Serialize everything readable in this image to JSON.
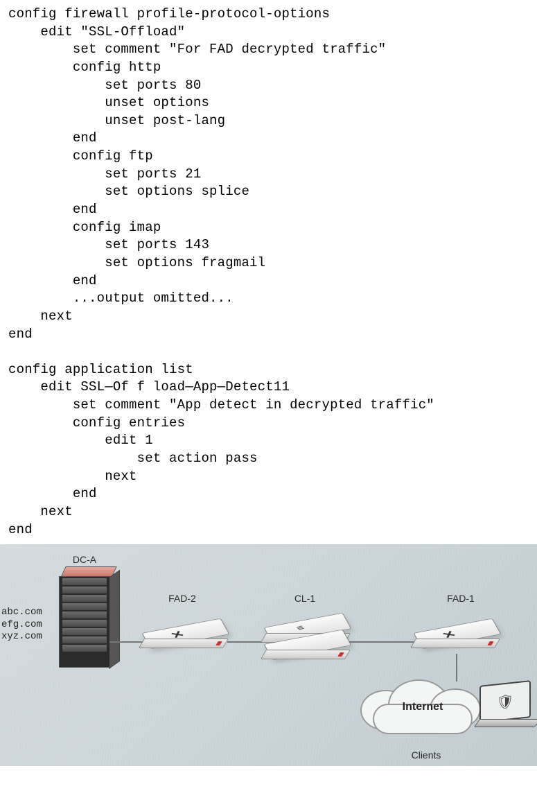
{
  "code": {
    "l01": "config firewall profile-protocol-options",
    "l02": "    edit \"SSL-Offload\"",
    "l03": "        set comment \"For FAD decrypted traffic\"",
    "l04": "        config http",
    "l05": "            set ports 80",
    "l06": "            unset options",
    "l07": "            unset post-lang",
    "l08": "        end",
    "l09": "        config ftp",
    "l10": "            set ports 21",
    "l11": "            set options splice",
    "l12": "        end",
    "l13": "        config imap",
    "l14": "            set ports 143",
    "l15": "            set options fragmail",
    "l16": "        end",
    "l17": "        ...output omitted...",
    "l18": "    next",
    "l19": "end",
    "l20": "",
    "l21": "config application list",
    "l22": "    edit SSL—Of f load—App—Detect11",
    "l23": "        set comment \"App detect in decrypted traffic\"",
    "l24": "        config entries",
    "l25": "            edit 1",
    "l26": "                set action pass",
    "l27": "            next",
    "l28": "        end",
    "l29": "    next",
    "l30": "end"
  },
  "diagram": {
    "dc_label": "DC-A",
    "domains": "abc.com\nefg.com\nxyz.com",
    "fad2": "FAD-2",
    "cl1": "CL-1",
    "fad1": "FAD-1",
    "internet": "Internet",
    "clients": "Clients"
  }
}
